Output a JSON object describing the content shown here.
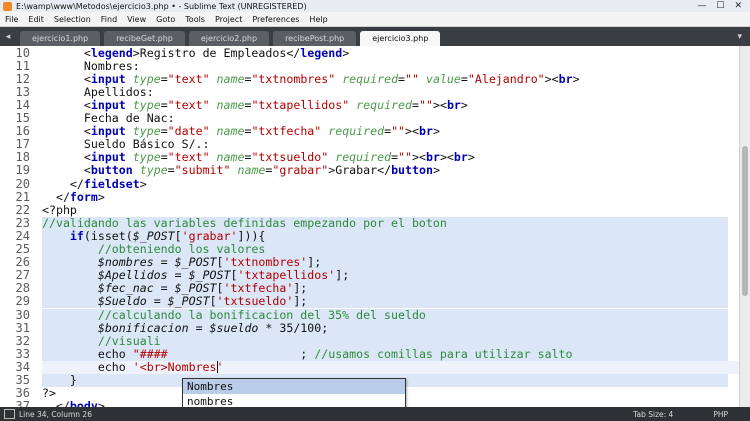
{
  "window": {
    "title": "E:\\wamp\\www\\Metodos\\ejercicio3.php • - Sublime Text (UNREGISTERED)",
    "minimize": "—",
    "maximize": "☐",
    "close": "✕"
  },
  "menu": [
    "File",
    "Edit",
    "Selection",
    "Find",
    "View",
    "Goto",
    "Tools",
    "Project",
    "Preferences",
    "Help"
  ],
  "tabs": {
    "left_arrow": "◂",
    "right_arrow": "▾",
    "items": [
      {
        "label": "ejercicio1.php",
        "active": false
      },
      {
        "label": "recibeGet.php",
        "active": false
      },
      {
        "label": "ejercicio2.php",
        "active": false
      },
      {
        "label": "recibePost.php",
        "active": false
      },
      {
        "label": "ejercicio3.php",
        "active": true
      }
    ]
  },
  "editor": {
    "line_numbers": [
      "10",
      "11",
      "12",
      "13",
      "14",
      "15",
      "16",
      "17",
      "18",
      "19",
      "20",
      "21",
      "22",
      "23",
      "24",
      "25",
      "26",
      "27",
      "28",
      "29",
      "30",
      "31",
      "32",
      "33",
      "34",
      "35",
      "36",
      "37"
    ],
    "lines": [
      [
        [
          "plain",
          "      <"
        ],
        [
          "tag",
          "legend"
        ],
        [
          "plain",
          ">Registro de Empleados</"
        ],
        [
          "tag",
          "legend"
        ],
        [
          "plain",
          ">"
        ]
      ],
      [
        [
          "plain",
          "      Nombres:"
        ]
      ],
      [
        [
          "plain",
          "      <"
        ],
        [
          "tag",
          "input"
        ],
        [
          "plain",
          " "
        ],
        [
          "attr",
          "type"
        ],
        [
          "plain",
          "="
        ],
        [
          "str",
          "\"text\""
        ],
        [
          "plain",
          " "
        ],
        [
          "attr",
          "name"
        ],
        [
          "plain",
          "="
        ],
        [
          "str",
          "\"txtnombres\""
        ],
        [
          "plain",
          " "
        ],
        [
          "attr",
          "required"
        ],
        [
          "plain",
          "="
        ],
        [
          "str",
          "\"\""
        ],
        [
          "plain",
          " "
        ],
        [
          "attr",
          "value"
        ],
        [
          "plain",
          "="
        ],
        [
          "str",
          "\"Alejandro\""
        ],
        [
          "plain",
          "><"
        ],
        [
          "tag",
          "br"
        ],
        [
          "plain",
          ">"
        ]
      ],
      [
        [
          "plain",
          "      Apellidos:"
        ]
      ],
      [
        [
          "plain",
          "      <"
        ],
        [
          "tag",
          "input"
        ],
        [
          "plain",
          " "
        ],
        [
          "attr",
          "type"
        ],
        [
          "plain",
          "="
        ],
        [
          "str",
          "\"text\""
        ],
        [
          "plain",
          " "
        ],
        [
          "attr",
          "name"
        ],
        [
          "plain",
          "="
        ],
        [
          "str",
          "\"txtapellidos\""
        ],
        [
          "plain",
          " "
        ],
        [
          "attr",
          "required"
        ],
        [
          "plain",
          "="
        ],
        [
          "str",
          "\"\""
        ],
        [
          "plain",
          "><"
        ],
        [
          "tag",
          "br"
        ],
        [
          "plain",
          ">"
        ]
      ],
      [
        [
          "plain",
          "      Fecha de Nac:"
        ]
      ],
      [
        [
          "plain",
          "      <"
        ],
        [
          "tag",
          "input"
        ],
        [
          "plain",
          " "
        ],
        [
          "attr",
          "type"
        ],
        [
          "plain",
          "="
        ],
        [
          "str",
          "\"date\""
        ],
        [
          "plain",
          " "
        ],
        [
          "attr",
          "name"
        ],
        [
          "plain",
          "="
        ],
        [
          "str",
          "\"txtfecha\""
        ],
        [
          "plain",
          " "
        ],
        [
          "attr",
          "required"
        ],
        [
          "plain",
          "="
        ],
        [
          "str",
          "\"\""
        ],
        [
          "plain",
          "><"
        ],
        [
          "tag",
          "br"
        ],
        [
          "plain",
          ">"
        ]
      ],
      [
        [
          "plain",
          "      Sueldo Básico S/.:"
        ]
      ],
      [
        [
          "plain",
          "      <"
        ],
        [
          "tag",
          "input"
        ],
        [
          "plain",
          " "
        ],
        [
          "attr",
          "type"
        ],
        [
          "plain",
          "="
        ],
        [
          "str",
          "\"text\""
        ],
        [
          "plain",
          " "
        ],
        [
          "attr",
          "name"
        ],
        [
          "plain",
          "="
        ],
        [
          "str",
          "\"txtsueldo\""
        ],
        [
          "plain",
          " "
        ],
        [
          "attr",
          "required"
        ],
        [
          "plain",
          "="
        ],
        [
          "str",
          "\"\""
        ],
        [
          "plain",
          "><"
        ],
        [
          "tag",
          "br"
        ],
        [
          "plain",
          "><"
        ],
        [
          "tag",
          "br"
        ],
        [
          "plain",
          ">"
        ]
      ],
      [
        [
          "plain",
          "      <"
        ],
        [
          "tag",
          "button"
        ],
        [
          "plain",
          " "
        ],
        [
          "attr",
          "type"
        ],
        [
          "plain",
          "="
        ],
        [
          "str",
          "\"submit\""
        ],
        [
          "plain",
          " "
        ],
        [
          "attr",
          "name"
        ],
        [
          "plain",
          "="
        ],
        [
          "str",
          "\"grabar\""
        ],
        [
          "plain",
          ">Grabar</"
        ],
        [
          "tag",
          "button"
        ],
        [
          "plain",
          ">"
        ]
      ],
      [
        [
          "plain",
          "    </"
        ],
        [
          "tag",
          "fieldset"
        ],
        [
          "plain",
          ">"
        ]
      ],
      [
        [
          "plain",
          "  </"
        ],
        [
          "tag",
          "form"
        ],
        [
          "plain",
          ">"
        ]
      ],
      [
        [
          "plain",
          "<?php"
        ]
      ],
      [
        [
          "com",
          "//validando las variables definidas empezando por el boton"
        ]
      ],
      [
        [
          "plain",
          "    "
        ],
        [
          "kw",
          "if"
        ],
        [
          "plain",
          "(isset("
        ],
        [
          "var",
          "$_POST"
        ],
        [
          "plain",
          "["
        ],
        [
          "str",
          "'grabar'"
        ],
        [
          "plain",
          "])){"
        ]
      ],
      [
        [
          "plain",
          "        "
        ],
        [
          "com",
          "//obteniendo los valores"
        ]
      ],
      [
        [
          "plain",
          "        "
        ],
        [
          "var",
          "$nombres"
        ],
        [
          "plain",
          " = "
        ],
        [
          "var",
          "$_POST"
        ],
        [
          "plain",
          "["
        ],
        [
          "str",
          "'txtnombres'"
        ],
        [
          "plain",
          "];"
        ]
      ],
      [
        [
          "plain",
          "        "
        ],
        [
          "var",
          "$Apellidos"
        ],
        [
          "plain",
          " = "
        ],
        [
          "var",
          "$_POST"
        ],
        [
          "plain",
          "["
        ],
        [
          "str",
          "'txtapellidos'"
        ],
        [
          "plain",
          "];"
        ]
      ],
      [
        [
          "plain",
          "        "
        ],
        [
          "var",
          "$fec_nac"
        ],
        [
          "plain",
          " = "
        ],
        [
          "var",
          "$_POST"
        ],
        [
          "plain",
          "["
        ],
        [
          "str",
          "'txtfecha'"
        ],
        [
          "plain",
          "];"
        ]
      ],
      [
        [
          "plain",
          "        "
        ],
        [
          "var",
          "$Sueldo"
        ],
        [
          "plain",
          " = "
        ],
        [
          "var",
          "$_POST"
        ],
        [
          "plain",
          "["
        ],
        [
          "str",
          "'txtsueldo'"
        ],
        [
          "plain",
          "];"
        ]
      ],
      [
        [
          "plain",
          "        "
        ],
        [
          "com",
          "//calculando la bonificacion del 35% del sueldo"
        ]
      ],
      [
        [
          "plain",
          "        "
        ],
        [
          "var",
          "$bonificacion"
        ],
        [
          "plain",
          " = "
        ],
        [
          "var",
          "$sueldo"
        ],
        [
          "plain",
          " * 35/100;"
        ]
      ],
      [
        [
          "plain",
          "        "
        ],
        [
          "com",
          "//visuali"
        ]
      ],
      [
        [
          "plain",
          "        echo "
        ],
        [
          "str",
          "\"####"
        ],
        [
          "plain",
          "                   ; "
        ],
        [
          "com",
          "//usamos comillas para utilizar salto"
        ]
      ],
      [
        [
          "plain",
          "        echo "
        ],
        [
          "str",
          "'<br>Nombres'"
        ]
      ],
      [
        [
          "plain",
          "    }"
        ]
      ],
      [
        [
          "plain",
          "?>"
        ]
      ],
      [
        [
          "plain",
          "  </"
        ],
        [
          "tag",
          "body"
        ],
        [
          "plain",
          ">"
        ]
      ]
    ],
    "autocomplete": [
      "Nombres",
      "nombres"
    ]
  },
  "status": {
    "position": "Line 34, Column 26",
    "tab_size": "Tab Size: 4",
    "syntax": "PHP"
  }
}
